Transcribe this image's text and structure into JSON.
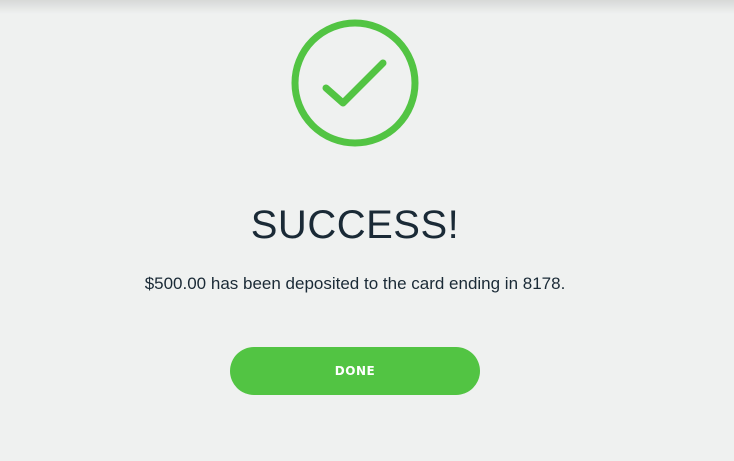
{
  "success": {
    "icon": "check-circle-icon",
    "title": "SUCCESS!",
    "message": "$500.00 has been deposited to the card ending in 8178.",
    "done_label": "DONE"
  },
  "colors": {
    "background": "#eff1f0",
    "accent": "#52c443",
    "text": "#1a2a36"
  }
}
